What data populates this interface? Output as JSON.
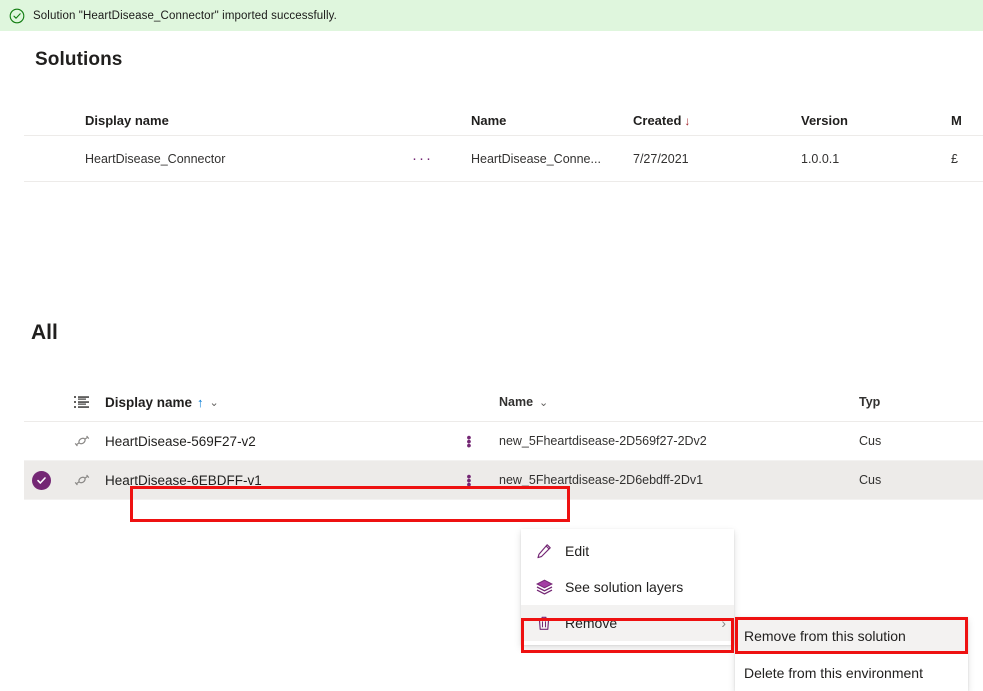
{
  "banner": {
    "icon": "circle-check-icon",
    "message": "Solution \"HeartDisease_Connector\" imported successfully.",
    "background_color": "#dff6dd",
    "icon_color": "#107c10"
  },
  "solutions_section": {
    "title": "Solutions",
    "columns": {
      "display_name": "Display name",
      "name": "Name",
      "created": "Created",
      "created_sort": "↓",
      "version": "Version",
      "managed": "M"
    },
    "rows": [
      {
        "display_name": "HeartDisease_Connector",
        "overflow": "···",
        "name": "HeartDisease_Conne...",
        "created": "7/27/2021",
        "version": "1.0.0.1",
        "managed": "£"
      }
    ]
  },
  "all_section": {
    "title": "All",
    "columns": {
      "list_icon": "list-view-icon",
      "display_name": "Display name",
      "display_name_sort_asc": "↑",
      "display_name_chevron": "⌄",
      "name": "Name",
      "name_chevron": "⌄",
      "type": "Typ"
    },
    "rows": [
      {
        "selected": false,
        "icon": "connector-icon",
        "display_name": "HeartDisease-569F27-v2",
        "row_menu": "vertical-ellipsis",
        "name": "new_5Fheartdisease-2D569f27-2Dv2",
        "type": "Cus"
      },
      {
        "selected": true,
        "selected_badge": "✓",
        "icon": "connector-icon",
        "display_name": "HeartDisease-6EBDFF-v1",
        "row_menu": "vertical-ellipsis",
        "name": "new_5Fheartdisease-2D6ebdff-2Dv1",
        "type": "Cus"
      }
    ]
  },
  "context_menu": {
    "items": [
      {
        "icon": "pencil-icon",
        "label": "Edit"
      },
      {
        "icon": "layers-icon",
        "label": "See solution layers"
      },
      {
        "icon": "trash-icon",
        "label": "Remove",
        "chevron": "›",
        "active": true
      }
    ]
  },
  "submenu": {
    "items": [
      {
        "label": "Remove from this solution",
        "active": true
      },
      {
        "label": "Delete from this environment",
        "active": false
      }
    ]
  },
  "theme": {
    "accent_purple": "#742774",
    "selection_purple": "#742774",
    "annotation_red": "#ee1111",
    "selected_row_bg": "#edebe9",
    "sort_arrow_blue": "#0078d4",
    "created_sort_red": "#a4262c"
  }
}
